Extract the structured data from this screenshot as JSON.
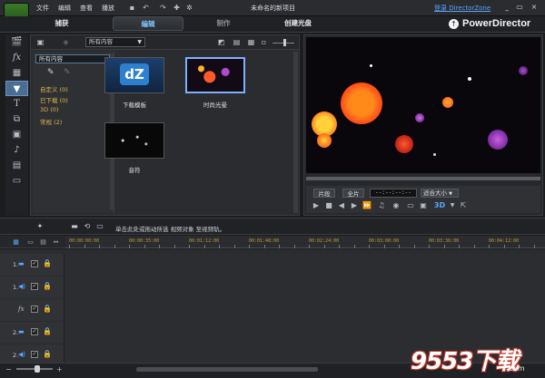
{
  "menu": {
    "file": "文件",
    "edit": "编辑",
    "view": "查看",
    "play": "播放",
    "project_title": "未命名的新项目",
    "login_link": "登录 DirectorZone",
    "minimize": "_",
    "restore": "▭",
    "close": "×"
  },
  "modes": {
    "capture": "捕获",
    "edit": "编辑",
    "produce": "制作",
    "create_disc": "创建光盘"
  },
  "brand": "PowerDirector",
  "library": {
    "filter_label": "所有内容",
    "categories_root": "所有内容",
    "categories": [
      {
        "label": "自定义",
        "count": "(0)"
      },
      {
        "label": "已下载",
        "count": "(0)"
      },
      {
        "label": "3D",
        "count": "(0)"
      },
      {
        "label": "常规",
        "count": "(2)"
      }
    ],
    "thumbnails": [
      {
        "label": "下载模板",
        "badge": "dZ"
      },
      {
        "label": "时尚光晕"
      },
      {
        "label": "音符"
      }
    ]
  },
  "preview": {
    "clip_button": "片段",
    "movie_button": "全片",
    "timecode": "--:--:--:--",
    "fit_select": "适合大小",
    "threeD": "3D"
  },
  "timeline": {
    "hint": "单击此处或拖动所选 视频对象 至视频轨。",
    "ruler_labels": [
      "00:00:00:00",
      "00:00:35:00",
      "00:01:12:00",
      "00:01:48:00",
      "00:02:24:00",
      "00:03:00:00",
      "00:03:36:00",
      "00:04:12:00"
    ],
    "tracks": [
      {
        "num": "1.",
        "kind": "video"
      },
      {
        "num": "1.",
        "kind": "audio"
      },
      {
        "num": "",
        "kind": "fx"
      },
      {
        "num": "2.",
        "kind": "video"
      },
      {
        "num": "2.",
        "kind": "audio"
      }
    ]
  },
  "watermark": {
    "main": "9553下载",
    "sub": ".com"
  },
  "colors": {
    "accent": "#5aa7ff",
    "category_text": "#e0b84a",
    "ruler_text": "#c89a3a"
  }
}
